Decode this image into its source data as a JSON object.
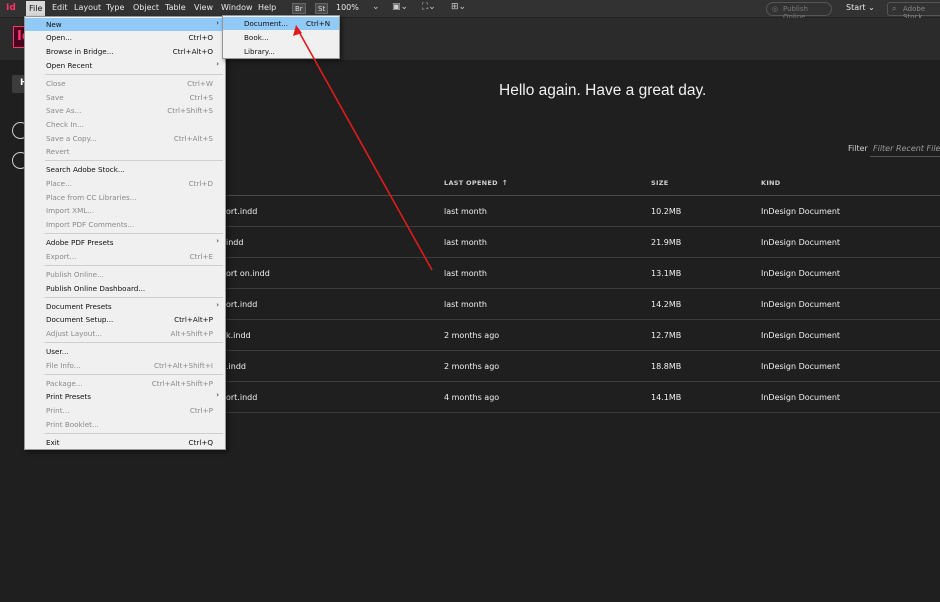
{
  "menubar": {
    "logo": "Id",
    "items": [
      "File",
      "Edit",
      "Layout",
      "Type",
      "Object",
      "Table",
      "View",
      "Window",
      "Help"
    ],
    "bridge_btn": "Br",
    "stock_btn": "St",
    "zoom": "100%",
    "publish_online": "Publish Online",
    "workspace": "Start",
    "stock_search_placeholder": "Adobe Stock"
  },
  "app_logo": "Id",
  "home_button": "H",
  "greeting": "Hello again. Have a great day.",
  "filter": {
    "label": "Filter",
    "placeholder": "Filter Recent Files"
  },
  "table": {
    "columns": {
      "last_opened": "LAST OPENED",
      "size": "SIZE",
      "kind": "KIND"
    },
    "sort_indicator": "↑",
    "rows": [
      {
        "name": "ort.indd",
        "last": "last month",
        "size": "10.2MB",
        "kind": "InDesign Document"
      },
      {
        "name": "indd",
        "last": "last month",
        "size": "21.9MB",
        "kind": "InDesign Document"
      },
      {
        "name": "ort on.indd",
        "last": "last month",
        "size": "13.1MB",
        "kind": "InDesign Document"
      },
      {
        "name": "ort.indd",
        "last": "last month",
        "size": "14.2MB",
        "kind": "InDesign Document"
      },
      {
        "name": "k.indd",
        "last": "2 months ago",
        "size": "12.7MB",
        "kind": "InDesign Document"
      },
      {
        "name": ".indd",
        "last": "2 months ago",
        "size": "18.8MB",
        "kind": "InDesign Document"
      },
      {
        "name": "ort.indd",
        "last": "4 months ago",
        "size": "14.1MB",
        "kind": "InDesign Document"
      }
    ]
  },
  "file_menu": {
    "items": [
      {
        "label": "New",
        "shortcut": "",
        "submenu": true,
        "disabled": false,
        "highlight": true
      },
      {
        "label": "Open...",
        "shortcut": "Ctrl+O"
      },
      {
        "label": "Browse in Bridge...",
        "shortcut": "Ctrl+Alt+O"
      },
      {
        "label": "Open Recent",
        "shortcut": "",
        "submenu": true
      },
      {
        "label": "Close",
        "shortcut": "Ctrl+W",
        "disabled": true
      },
      {
        "label": "Save",
        "shortcut": "Ctrl+S",
        "disabled": true
      },
      {
        "label": "Save As...",
        "shortcut": "Ctrl+Shift+S",
        "disabled": true
      },
      {
        "label": "Check In...",
        "shortcut": "",
        "disabled": true
      },
      {
        "label": "Save a Copy...",
        "shortcut": "Ctrl+Alt+S",
        "disabled": true
      },
      {
        "label": "Revert",
        "shortcut": "",
        "disabled": true
      },
      {
        "label": "Search Adobe Stock...",
        "shortcut": ""
      },
      {
        "label": "Place...",
        "shortcut": "Ctrl+D",
        "disabled": true
      },
      {
        "label": "Place from CC Libraries...",
        "shortcut": "",
        "disabled": true
      },
      {
        "label": "Import XML...",
        "shortcut": "",
        "disabled": true
      },
      {
        "label": "Import PDF Comments...",
        "shortcut": "",
        "disabled": true
      },
      {
        "label": "Adobe PDF Presets",
        "shortcut": "",
        "submenu": true
      },
      {
        "label": "Export...",
        "shortcut": "Ctrl+E",
        "disabled": true
      },
      {
        "label": "Publish Online...",
        "shortcut": "",
        "disabled": true
      },
      {
        "label": "Publish Online Dashboard...",
        "shortcut": ""
      },
      {
        "label": "Document Presets",
        "shortcut": "",
        "submenu": true
      },
      {
        "label": "Document Setup...",
        "shortcut": "Ctrl+Alt+P"
      },
      {
        "label": "Adjust Layout...",
        "shortcut": "Alt+Shift+P",
        "disabled": true
      },
      {
        "label": "User...",
        "shortcut": ""
      },
      {
        "label": "File Info...",
        "shortcut": "Ctrl+Alt+Shift+I",
        "disabled": true
      },
      {
        "label": "Package...",
        "shortcut": "Ctrl+Alt+Shift+P",
        "disabled": true
      },
      {
        "label": "Print Presets",
        "shortcut": "",
        "submenu": true
      },
      {
        "label": "Print...",
        "shortcut": "Ctrl+P",
        "disabled": true
      },
      {
        "label": "Print Booklet...",
        "shortcut": "",
        "disabled": true
      },
      {
        "label": "Exit",
        "shortcut": "Ctrl+Q"
      }
    ],
    "submenu_arrow": "›"
  },
  "new_submenu": {
    "items": [
      {
        "label": "Document...",
        "shortcut": "Ctrl+N",
        "highlight": true
      },
      {
        "label": "Book...",
        "shortcut": ""
      },
      {
        "label": "Library...",
        "shortcut": ""
      }
    ]
  },
  "colors": {
    "accent": "#ff3366",
    "menu_highlight": "#91c9f7",
    "annotation_arrow": "#e11b1b",
    "background": "#1f1f1f"
  }
}
